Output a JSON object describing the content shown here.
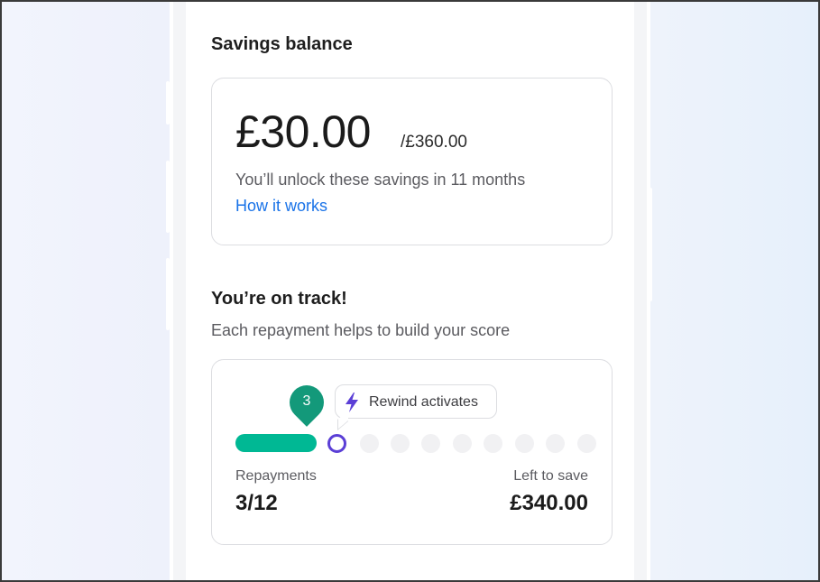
{
  "savings": {
    "title": "Savings balance",
    "amount": "£30.00",
    "total": "/£360.00",
    "unlock_text": "You’ll unlock these savings in 11 months",
    "link_label": "How it works"
  },
  "track": {
    "title": "You’re on track!",
    "subtitle": "Each repayment helps to build your score",
    "marker_number": "3",
    "tooltip": "Rewind activates",
    "progress": {
      "completed": 3,
      "total": 12
    },
    "repayments_label": "Repayments",
    "repayments_value": "3/12",
    "left_label": "Left to save",
    "left_value": "£340.00"
  },
  "colors": {
    "accent_green": "#00b894",
    "marker_green": "#13997a",
    "ring_purple": "#5b3fd6",
    "link_blue": "#1a73e8"
  },
  "icons": {
    "tooltip_icon": "lightning-bolt-icon"
  }
}
